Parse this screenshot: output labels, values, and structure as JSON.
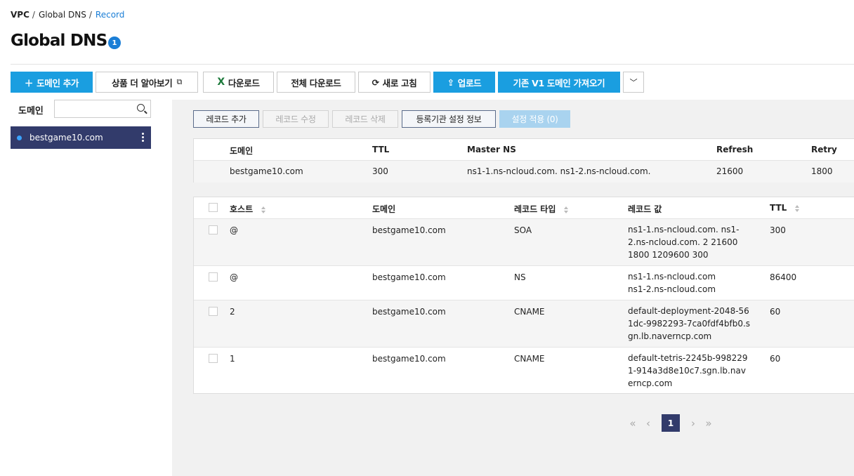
{
  "breadcrumb": [
    "VPC",
    "Global DNS",
    "Record"
  ],
  "page_title": "Global DNS",
  "title_badge": "1",
  "toolbar": {
    "add_domain": "도메인 추가",
    "learn_more": "상품 더 알아보기",
    "download": "다운로드",
    "download_all": "전체 다운로드",
    "refresh": "새로 고침",
    "upload": "업로드",
    "import_v1": "기존 V1 도메인 가져오기"
  },
  "sidebar": {
    "label": "도메인",
    "search_value": "",
    "search_placeholder": "",
    "domains": [
      "bestgame10.com"
    ]
  },
  "actions": {
    "add_record": "레코드 추가",
    "edit_record": "레코드 수정",
    "delete_record": "레코드 삭제",
    "registrar_info": "등록기관 설정 정보",
    "apply_settings": "설정 적용 (0)"
  },
  "soa_table": {
    "headers": [
      "도메인",
      "TTL",
      "Master NS",
      "Refresh",
      "Retry"
    ],
    "row": [
      "bestgame10.com",
      "300",
      "ns1-1.ns-ncloud.com. ns1-2.ns-ncloud.com.",
      "21600",
      "1800"
    ]
  },
  "record_table": {
    "headers": [
      "호스트",
      "도메인",
      "레코드 타입",
      "레코드 값",
      "TTL"
    ],
    "rows": [
      {
        "host": "@",
        "domain": "bestgame10.com",
        "type": "SOA",
        "value": "ns1-1.ns-ncloud.com. ns1-2.ns-ncloud.com. 2 21600 1800 1209600 300",
        "ttl": "300"
      },
      {
        "host": "@",
        "domain": "bestgame10.com",
        "type": "NS",
        "value": "ns1-1.ns-ncloud.com ns1-2.ns-ncloud.com",
        "ttl": "86400"
      },
      {
        "host": "2",
        "domain": "bestgame10.com",
        "type": "CNAME",
        "value": "default-deployment-2048-561dc-9982293-7ca0fdf4bfb0.sgn.lb.naverncp.com",
        "ttl": "60"
      },
      {
        "host": "1",
        "domain": "bestgame10.com",
        "type": "CNAME",
        "value": "default-tetris-2245b-9982291-914a3d8e10c7.sgn.lb.naverncp.com",
        "ttl": "60"
      }
    ]
  },
  "pagination": {
    "current_page": "1"
  },
  "colors": {
    "primary": "#1a9ee0",
    "navy": "#323b6b",
    "link": "#1a7ed6"
  }
}
